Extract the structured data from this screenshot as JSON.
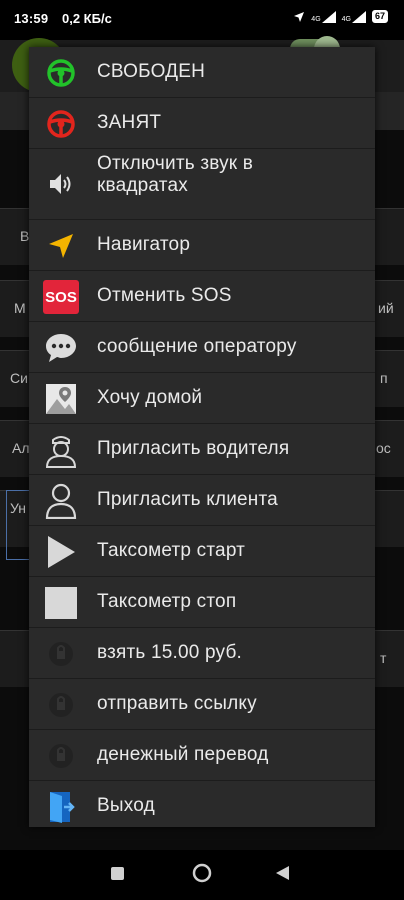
{
  "status_bar": {
    "time": "13:59",
    "speed": "0,2 КБ/с",
    "battery": "67",
    "signal_label": "4G",
    "signal_label2": "4G"
  },
  "background": {
    "labels": [
      {
        "text": "В",
        "row": "b1"
      },
      {
        "text": "М",
        "row": "b2"
      },
      {
        "text": "Си",
        "row": "b3"
      },
      {
        "text": "Ал",
        "row": "b4"
      },
      {
        "text": "Ун",
        "row": "b5"
      },
      {
        "text": "ий",
        "row": "r2"
      },
      {
        "text": "п",
        "row": "r3"
      },
      {
        "text": "ос",
        "row": "r4"
      },
      {
        "text": "т",
        "row": "r6"
      }
    ]
  },
  "menu": {
    "items": [
      {
        "label": "СВОБОДЕН",
        "icon": "steering-wheel-green-icon"
      },
      {
        "label": "ЗАНЯТ",
        "icon": "steering-wheel-red-icon"
      },
      {
        "label": "Отключить звук в\nквадратах",
        "icon": "speaker-icon"
      },
      {
        "label": "Навигатор",
        "icon": "navigation-arrow-icon"
      },
      {
        "label": "Отменить SOS",
        "icon": "sos-icon",
        "icon_text": "SOS"
      },
      {
        "label": "сообщение оператору",
        "icon": "chat-bubble-icon"
      },
      {
        "label": "Хочу домой",
        "icon": "map-pin-icon"
      },
      {
        "label": "Пригласить водителя",
        "icon": "driver-icon"
      },
      {
        "label": "Пригласить клиента",
        "icon": "person-icon"
      },
      {
        "label": "Таксометр старт",
        "icon": "play-icon"
      },
      {
        "label": "Таксометр стоп",
        "icon": "stop-icon"
      },
      {
        "label": "взять 15.00 руб.",
        "icon": "lock-icon"
      },
      {
        "label": "отправить ссылку",
        "icon": "lock-icon"
      },
      {
        "label": "денежный перевод",
        "icon": "lock-icon"
      },
      {
        "label": "Выход",
        "icon": "exit-door-icon"
      }
    ]
  },
  "colors": {
    "menu_bg": "#2a2a2a",
    "green": "#22c22a",
    "red": "#e2251d",
    "yellow": "#f4b400",
    "sos_red": "#e2253a",
    "exit_blue": "#1e88e5"
  }
}
